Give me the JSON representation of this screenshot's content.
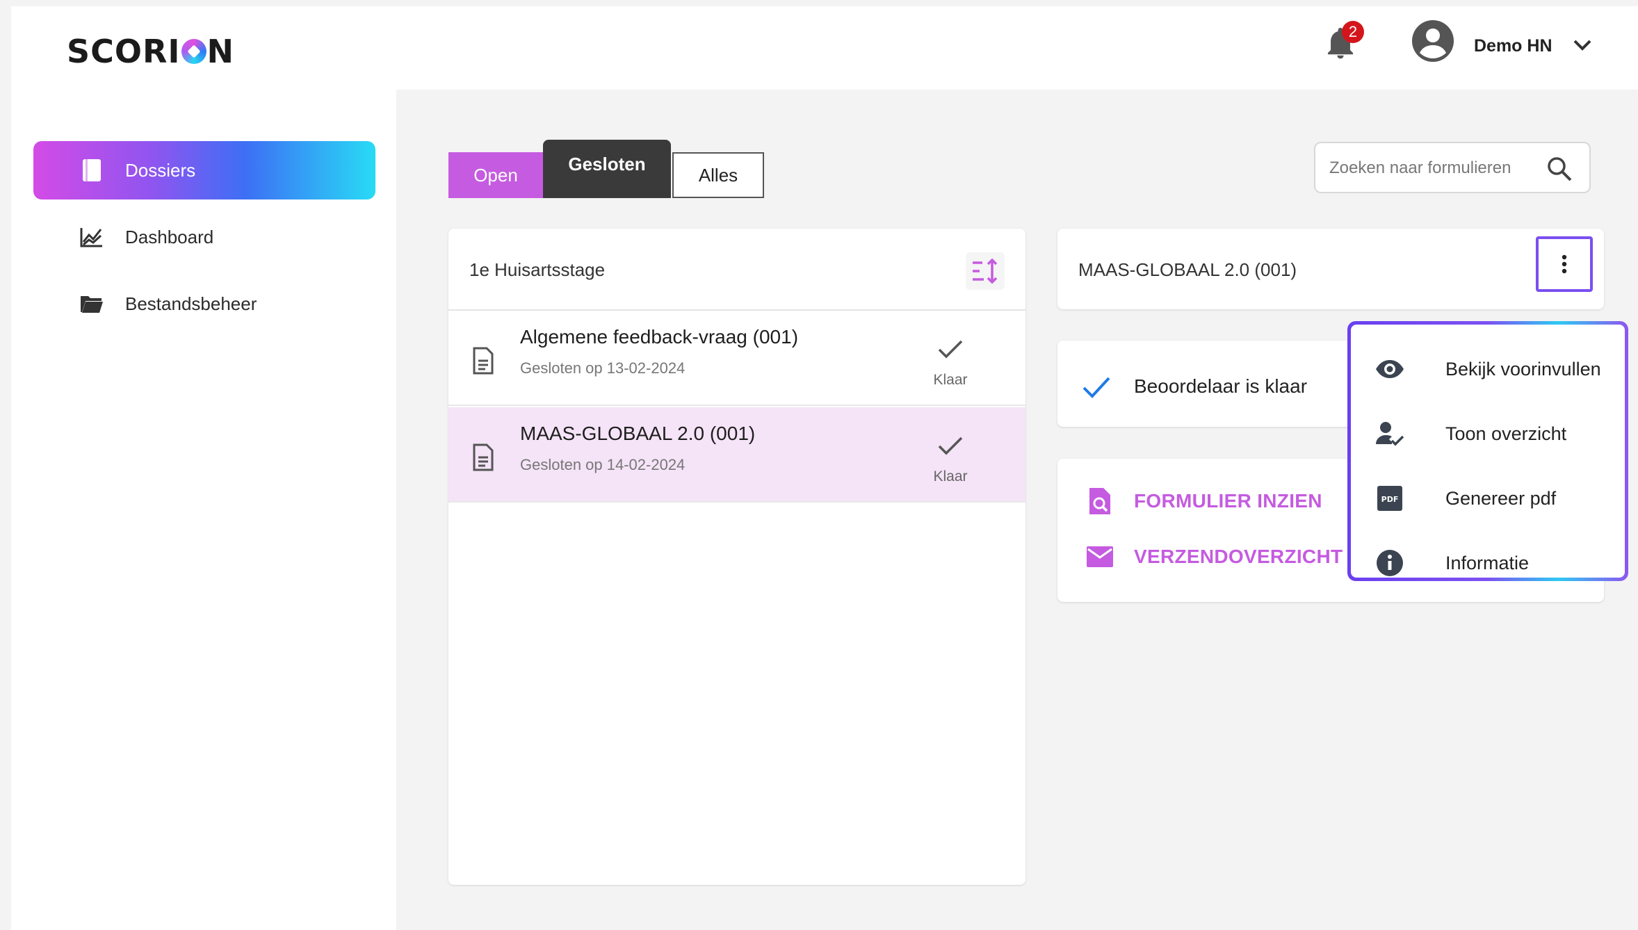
{
  "header": {
    "logo_text_a": "SCORI",
    "logo_text_b": "N",
    "notification_count": "2",
    "user_name": "Demo HN"
  },
  "sidebar": {
    "items": [
      {
        "label": "Dossiers",
        "icon": "book-icon",
        "active": true
      },
      {
        "label": "Dashboard",
        "icon": "chart-icon",
        "active": false
      },
      {
        "label": "Bestandsbeheer",
        "icon": "folder-icon",
        "active": false
      }
    ]
  },
  "tabs": {
    "open": "Open",
    "gesloten": "Gesloten",
    "alles": "Alles",
    "selected": "Gesloten"
  },
  "search": {
    "placeholder": "Zoeken naar formulieren"
  },
  "list": {
    "title": "1e Huisartsstage",
    "rows": [
      {
        "title": "Algemene feedback-vraag (001)",
        "date": "Gesloten op 13-02-2024",
        "status": "Klaar",
        "selected": false
      },
      {
        "title": "MAAS-GLOBAAL 2.0 (001)",
        "date": "Gesloten op 14-02-2024",
        "status": "Klaar",
        "selected": true
      }
    ]
  },
  "detail": {
    "title": "MAAS-GLOBAAL 2.0 (001)",
    "status_text": "Beoordelaar is klaar",
    "actions": [
      {
        "label": "FORMULIER INZIEN",
        "icon": "search-document-icon"
      },
      {
        "label": "VERZENDOVERZICHT",
        "icon": "mail-icon"
      }
    ]
  },
  "menu": {
    "items": [
      {
        "label": "Bekijk voorinvullen",
        "icon": "eye-icon"
      },
      {
        "label": "Toon overzicht",
        "icon": "user-check-icon"
      },
      {
        "label": "Genereer pdf",
        "icon": "pdf-icon"
      },
      {
        "label": "Informatie",
        "icon": "info-icon"
      }
    ]
  },
  "colors": {
    "accent": "#c55be0",
    "dark_tab": "#3a3a3a",
    "selected_row": "#f5e3f7",
    "check_blue": "#1e7be6"
  }
}
